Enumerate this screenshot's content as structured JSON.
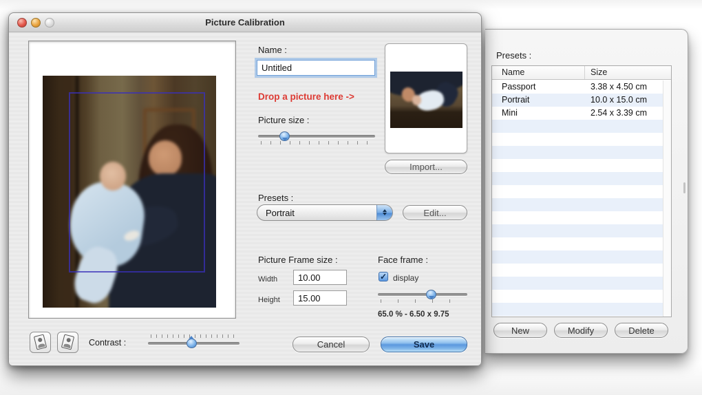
{
  "window": {
    "title": "Picture Calibration"
  },
  "form": {
    "name_label": "Name :",
    "name_value": "Untitled",
    "drop_hint": "Drop a picture here ->",
    "picture_size_label": "Picture size :",
    "import_button": "Import...",
    "presets_label": "Presets :",
    "preset_selected": "Portrait",
    "edit_button": "Edit...",
    "picture_frame_size_label": "Picture Frame size :",
    "width_label": "Width",
    "width_value": "10.00",
    "height_label": "Height",
    "height_value": "15.00",
    "face_frame_label": "Face frame :",
    "display_checkbox_label": "display",
    "display_checked": true,
    "face_frame_readout": "65.0 % - 6.50 x 9.75",
    "contrast_label": "Contrast :",
    "cancel_button": "Cancel",
    "save_button": "Save"
  },
  "sliders": {
    "picture_size_percent": 23,
    "face_frame_percent": 60,
    "contrast_percent": 48
  },
  "presets_panel": {
    "title": "Presets :",
    "columns": {
      "name": "Name",
      "size": "Size"
    },
    "rows": [
      {
        "name": "Passport",
        "size": "3.38 x 4.50 cm"
      },
      {
        "name": "Portrait",
        "size": "10.0 x 15.0 cm"
      },
      {
        "name": "Mini",
        "size": "2.54 x 3.39 cm"
      }
    ],
    "new_button": "New",
    "modify_button": "Modify",
    "delete_button": "Delete"
  },
  "icons": {
    "checkmark": "✓"
  },
  "colors": {
    "accent_blue": "#5b97d9",
    "save_button_blue": "#5b98de",
    "drop_hint_red": "#dd3b34",
    "face_frame_outline": "#3a30b9",
    "row_stripe_blue": "#e9f0fa"
  }
}
